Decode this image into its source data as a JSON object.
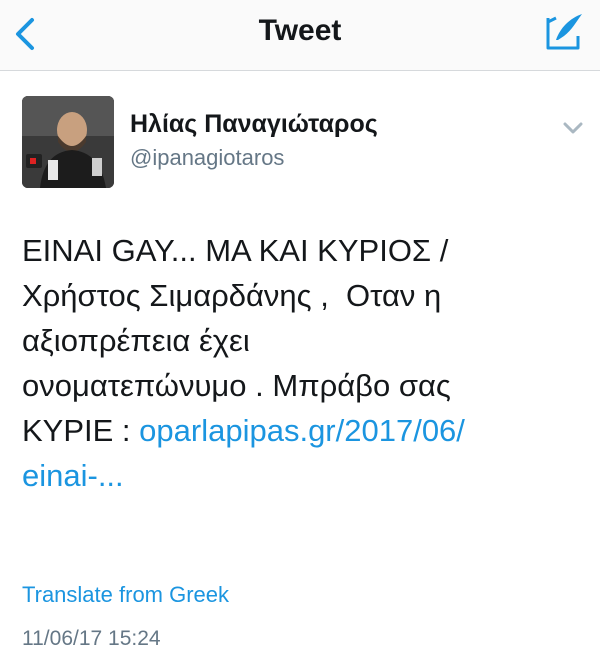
{
  "nav": {
    "title": "Tweet",
    "accent_color": "#1b95e0",
    "back_icon": "chevron-left-icon",
    "compose_icon": "compose-tweet-icon"
  },
  "tweet": {
    "author_name": "Ηλίας Παναγιώταρος",
    "author_handle": "@ipanagiotaros",
    "caret_icon": "chevron-down-icon",
    "text_lines": [
      "ΕΙΝΑΙ GAY... ΜΑ ΚΑΙ ΚΥΡΙΟΣ /",
      "Χρήστος Σιμαρδάνης ,  Οταν η",
      "αξιοπρέπεια έχει",
      "ονοματεπώνυμο . Μπράβο σας"
    ],
    "last_line_prefix": "ΚΥΡΙΕ : ",
    "link_line1": "oparlapipas.gr/2017/06/",
    "link_line2": "einai-...",
    "translate_label": "Translate from Greek",
    "timestamp": "11/06/17 15:24"
  }
}
